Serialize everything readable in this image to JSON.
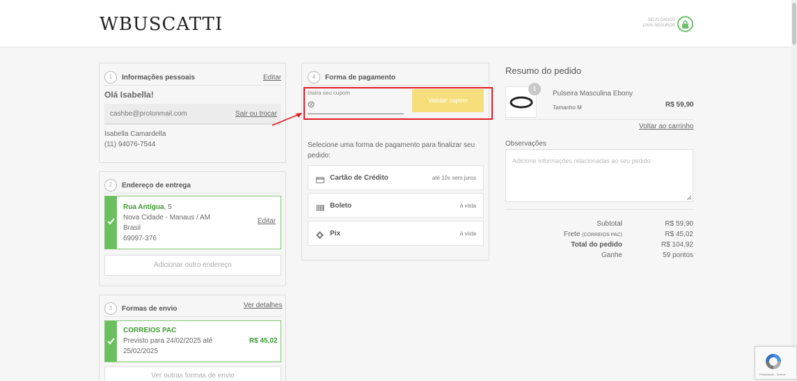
{
  "header": {
    "logo": "WBUSCATTI",
    "secure_line1": "SEUS DADOS",
    "secure_line2": "100% SEGUROS"
  },
  "personal": {
    "step": "1",
    "title": "Informações pessoais",
    "edit_label": "Editar",
    "greeting": "Olá Isabella!",
    "email": "cashbe@protonmail.com",
    "change_label": "Sair ou trocar",
    "name": "Isabella Camardella",
    "phone": "(11) 94076-7544"
  },
  "address": {
    "step": "2",
    "title": "Endereço de entrega",
    "street": "Rua Antígua",
    "number": ", 5",
    "city": "Nova Cidade - Manaus / AM",
    "country": "Brasil",
    "zip": "69097-376",
    "edit_label": "Editar",
    "add_label": "Adicionar outro endereço"
  },
  "shipping": {
    "step": "3",
    "title": "Formas de envio",
    "details_label": "Ver detalhes",
    "carrier": "CORREIOS PAC",
    "eta_line1": "Previsto para 24/02/2025 até",
    "eta_line2": "25/02/2025",
    "price": "R$ 45,02",
    "other_label": "Ver outras formas de envio"
  },
  "payment": {
    "step": "4",
    "title": "Forma de pagamento",
    "coupon_label": "Insira seu cupom",
    "coupon_button": "Validar cupom",
    "instruction_line1": "Selecione uma forma de pagamento para finalizar seu",
    "instruction_line2": "pedido:",
    "options": [
      {
        "label": "Cartão de Crédito",
        "note": "até 10x sem juros",
        "icon": "credit-card-icon"
      },
      {
        "label": "Boleto",
        "note": "à vista",
        "icon": "barcode-icon"
      },
      {
        "label": "Pix",
        "note": "à vista",
        "icon": "pix-icon"
      }
    ]
  },
  "summary": {
    "title": "Resumo do pedido",
    "product_name": "Pulseira Masculina Ebony",
    "product_size": "Tamanho M",
    "product_price": "R$ 59,90",
    "quantity": "1",
    "back_label": "Voltar ao carrinho",
    "obs_label": "Observações",
    "obs_placeholder": "Adicione informações relacionadas ao seu pedido",
    "subtotal_label": "Subtotal",
    "subtotal": "R$ 59,90",
    "frete_label": "Frete",
    "frete_detail": "(CORREIOS PAC)",
    "frete": "R$ 45,02",
    "total_label": "Total do pedido",
    "total": "R$ 104,92",
    "ganhe_label": "Ganhe",
    "ganhe": "59 pontos"
  },
  "recaptcha": {
    "footer": "Privacidade - Termos"
  },
  "colors": {
    "accent_green": "#6cbf5e",
    "coupon_yellow": "#f6df7b",
    "highlight_red": "#e11b22"
  }
}
